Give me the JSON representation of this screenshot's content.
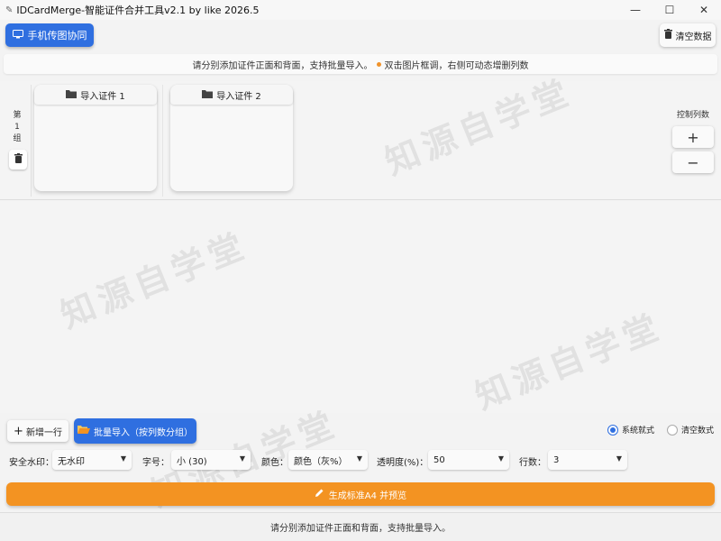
{
  "window": {
    "title": "IDCardMerge-智能证件合并工具v2.1 by like 2026.5",
    "controls": {
      "minimize": "—",
      "maximize": "☐",
      "close": "✕"
    }
  },
  "toolbar": {
    "phone_label": "手机传图协同",
    "clear_label": "清空数据"
  },
  "hint": {
    "text_before": "请分别添加证件正面和背面，支持批量导入。",
    "text_after": "双击图片框调，右侧可动态增删列数",
    "dot_color": "#f0932b"
  },
  "workarea": {
    "group_label": "第1组",
    "cards": [
      {
        "label": "导入证件 1"
      },
      {
        "label": "导入证件 2"
      }
    ],
    "column_control_label": "控制列数",
    "add_col": "+",
    "remove_col": "−"
  },
  "watermark_text": "知源自学堂",
  "bottom": {
    "add_row_label": "新增一行",
    "batch_import_label": "批量导入（按列数分组）",
    "modes": [
      {
        "label": "系统就式",
        "selected": true
      },
      {
        "label": "清空数式",
        "selected": false
      }
    ],
    "settings": {
      "watermark_label": "安全水印：",
      "watermark_value": "无水印",
      "font_size_label": "字号：",
      "font_size_value": "小 (30)",
      "color_label": "颜色：",
      "color_value": "颜色（灰%）",
      "opacity_label": "透明度(%)：",
      "opacity_value": "50",
      "rows_label": "行数：",
      "rows_value": "3"
    },
    "generate_label": "生成标准A4 并预览",
    "status_text": "请分别添加证件正面和背面，支持批量导入。"
  },
  "colors": {
    "primary_blue": "#2f6fe0",
    "accent_orange": "#f39322"
  }
}
